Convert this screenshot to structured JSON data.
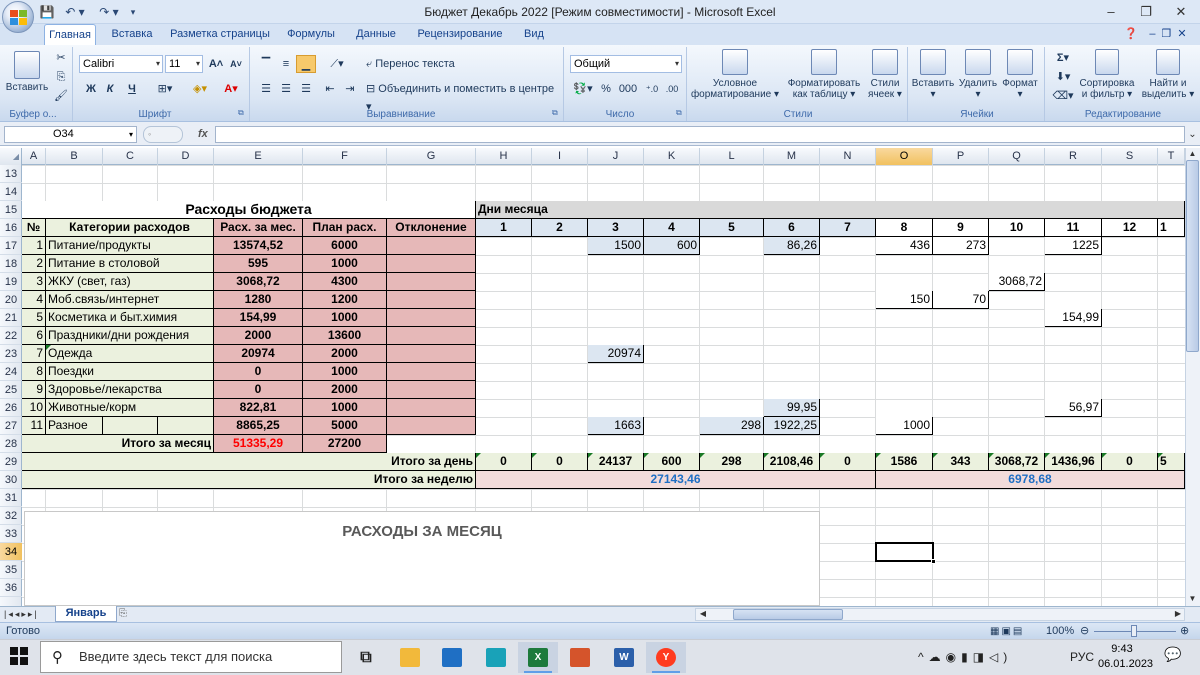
{
  "window": {
    "title": "Бюджет Декабрь 2022  [Режим совместимости]  -  Microsoft Excel",
    "controls": [
      "–",
      "❐",
      "✕"
    ]
  },
  "ribbon": {
    "tabs": [
      "Главная",
      "Вставка",
      "Разметка страницы",
      "Формулы",
      "Данные",
      "Рецензирование",
      "Вид"
    ],
    "groups": {
      "clipboard": {
        "label": "Буфер о...",
        "paste": "Вставить"
      },
      "font": {
        "label": "Шрифт",
        "name": "Calibri",
        "size": "11",
        "bold": "Ж",
        "italic": "К",
        "underline": "Ч"
      },
      "alignment": {
        "label": "Выравнивание",
        "wrap": "Перенос текста",
        "merge": "Объединить и поместить в центре"
      },
      "number": {
        "label": "Число",
        "format": "Общий",
        "percent": "%",
        "thousands": "000"
      },
      "styles": {
        "label": "Стили",
        "conditional": [
          "Условное",
          "форматирование"
        ],
        "table": [
          "Форматировать",
          "как таблицу"
        ],
        "cell_styles": [
          "Стили",
          "ячеек"
        ]
      },
      "cells": {
        "label": "Ячейки",
        "insert": "Вставить",
        "delete": "Удалить",
        "format": "Формат"
      },
      "editing": {
        "label": "Редактирование",
        "sort": [
          "Сортировка",
          "и фильтр"
        ],
        "find": [
          "Найти и",
          "выделить"
        ],
        "sum": "Σ"
      }
    }
  },
  "formula_bar": {
    "name_box": "O34",
    "fx": "fx",
    "content": ""
  },
  "columns": [
    "A",
    "B",
    "C",
    "D",
    "E",
    "F",
    "G",
    "H",
    "I",
    "J",
    "K",
    "L",
    "M",
    "N",
    "O",
    "P",
    "Q",
    "R",
    "S",
    "T"
  ],
  "rows": [
    13,
    14,
    15,
    16,
    17,
    18,
    19,
    20,
    21,
    22,
    23,
    24,
    25,
    26,
    27,
    28,
    29,
    30,
    31,
    32,
    33,
    34,
    35,
    36
  ],
  "selected": {
    "col": "O",
    "row": 34
  },
  "colors": {
    "pink": "#e6b8b8",
    "light_blue": "#dce6f1",
    "green": "#ebf1de",
    "pink_light": "#f2dcdb",
    "gray": "#d9d9d9"
  },
  "cells": [
    {
      "r": 15,
      "c": "A",
      "span": "G",
      "t": "Расходы бюджета",
      "cls": "b c big",
      "bg": "#ffffff"
    },
    {
      "r": 15,
      "c": "H",
      "span": "T",
      "t": "Дни месяца",
      "cls": "b l nbtop",
      "bg": "#d9d9d9"
    },
    {
      "r": 16,
      "c": "A",
      "t": "№",
      "cls": "b c",
      "bg": "#ebf1de"
    },
    {
      "r": 16,
      "c": "B",
      "span": "D",
      "t": "Категории расходов",
      "cls": "b c",
      "bg": "#ebf1de"
    },
    {
      "r": 16,
      "c": "E",
      "t": "Расх. за мес.",
      "cls": "b c",
      "bg": "#e6b8b8"
    },
    {
      "r": 16,
      "c": "F",
      "t": "План расх.",
      "cls": "b c",
      "bg": "#e6b8b8"
    },
    {
      "r": 16,
      "c": "G",
      "t": "Отклонение",
      "cls": "b c",
      "bg": "#e6b8b8"
    },
    {
      "r": 16,
      "c": "H",
      "t": "1",
      "cls": "b c",
      "bg": "#dce6f1"
    },
    {
      "r": 16,
      "c": "I",
      "t": "2",
      "cls": "b c",
      "bg": "#dce6f1"
    },
    {
      "r": 16,
      "c": "J",
      "t": "3",
      "cls": "b c",
      "bg": "#dce6f1"
    },
    {
      "r": 16,
      "c": "K",
      "t": "4",
      "cls": "b c",
      "bg": "#dce6f1"
    },
    {
      "r": 16,
      "c": "L",
      "t": "5",
      "cls": "b c",
      "bg": "#dce6f1"
    },
    {
      "r": 16,
      "c": "M",
      "t": "6",
      "cls": "b c",
      "bg": "#dce6f1"
    },
    {
      "r": 16,
      "c": "N",
      "t": "7",
      "cls": "b c",
      "bg": "#dce6f1"
    },
    {
      "r": 16,
      "c": "O",
      "t": "8",
      "cls": "b c",
      "bg": "#ffffff"
    },
    {
      "r": 16,
      "c": "P",
      "t": "9",
      "cls": "b c",
      "bg": "#ffffff"
    },
    {
      "r": 16,
      "c": "Q",
      "t": "10",
      "cls": "b c",
      "bg": "#ffffff"
    },
    {
      "r": 16,
      "c": "R",
      "t": "11",
      "cls": "b c",
      "bg": "#ffffff"
    },
    {
      "r": 16,
      "c": "S",
      "t": "12",
      "cls": "b c",
      "bg": "#ffffff"
    },
    {
      "r": 16,
      "c": "T",
      "t": "1",
      "cls": "b l",
      "bg": "#ffffff"
    },
    {
      "r": 17,
      "c": "A",
      "t": "1",
      "cls": "r",
      "bg": "#ebf1de"
    },
    {
      "r": 17,
      "c": "B",
      "span": "D",
      "t": "Питание/продукты",
      "cls": "l",
      "bg": "#ebf1de"
    },
    {
      "r": 17,
      "c": "E",
      "t": "13574,52",
      "cls": "b c",
      "bg": "#e6b8b8"
    },
    {
      "r": 17,
      "c": "F",
      "t": "6000",
      "cls": "b c",
      "bg": "#e6b8b8"
    },
    {
      "r": 17,
      "c": "G",
      "t": "",
      "bg": "#e6b8b8"
    },
    {
      "r": 17,
      "c": "J",
      "t": "1500",
      "cls": "r",
      "bg": "#dce6f1"
    },
    {
      "r": 17,
      "c": "K",
      "t": "600",
      "cls": "r",
      "bg": "#dce6f1"
    },
    {
      "r": 17,
      "c": "M",
      "t": "86,26",
      "cls": "r",
      "bg": "#dce6f1"
    },
    {
      "r": 17,
      "c": "O",
      "t": "436",
      "cls": "r",
      "bg": "#ffffff"
    },
    {
      "r": 17,
      "c": "P",
      "t": "273",
      "cls": "r",
      "bg": "#ffffff"
    },
    {
      "r": 17,
      "c": "R",
      "t": "1225",
      "cls": "r",
      "bg": "#ffffff"
    },
    {
      "r": 18,
      "c": "A",
      "t": "2",
      "cls": "r",
      "bg": "#ebf1de"
    },
    {
      "r": 18,
      "c": "B",
      "span": "D",
      "t": "Питание в столовой",
      "cls": "l",
      "bg": "#ebf1de"
    },
    {
      "r": 18,
      "c": "E",
      "t": "595",
      "cls": "b c",
      "bg": "#e6b8b8"
    },
    {
      "r": 18,
      "c": "F",
      "t": "1000",
      "cls": "b c",
      "bg": "#e6b8b8"
    },
    {
      "r": 18,
      "c": "G",
      "t": "",
      "bg": "#e6b8b8"
    },
    {
      "r": 19,
      "c": "A",
      "t": "3",
      "cls": "r",
      "bg": "#ebf1de"
    },
    {
      "r": 19,
      "c": "B",
      "span": "D",
      "t": "ЖКУ (свет, газ)",
      "cls": "l",
      "bg": "#ebf1de"
    },
    {
      "r": 19,
      "c": "E",
      "t": "3068,72",
      "cls": "b c",
      "bg": "#e6b8b8"
    },
    {
      "r": 19,
      "c": "F",
      "t": "4300",
      "cls": "b c",
      "bg": "#e6b8b8"
    },
    {
      "r": 19,
      "c": "G",
      "t": "",
      "bg": "#e6b8b8"
    },
    {
      "r": 19,
      "c": "Q",
      "t": "3068,72",
      "cls": "r",
      "bg": "#ffffff"
    },
    {
      "r": 20,
      "c": "A",
      "t": "4",
      "cls": "r",
      "bg": "#ebf1de"
    },
    {
      "r": 20,
      "c": "B",
      "span": "D",
      "t": "Моб.связь/интернет",
      "cls": "l",
      "bg": "#ebf1de"
    },
    {
      "r": 20,
      "c": "E",
      "t": "1280",
      "cls": "b c",
      "bg": "#e6b8b8"
    },
    {
      "r": 20,
      "c": "F",
      "t": "1200",
      "cls": "b c",
      "bg": "#e6b8b8"
    },
    {
      "r": 20,
      "c": "G",
      "t": "",
      "bg": "#e6b8b8"
    },
    {
      "r": 20,
      "c": "O",
      "t": "150",
      "cls": "r",
      "bg": "#ffffff"
    },
    {
      "r": 20,
      "c": "P",
      "t": "70",
      "cls": "r",
      "bg": "#ffffff"
    },
    {
      "r": 21,
      "c": "A",
      "t": "5",
      "cls": "r",
      "bg": "#ebf1de"
    },
    {
      "r": 21,
      "c": "B",
      "span": "D",
      "t": "Косметика и быт.химия",
      "cls": "l",
      "bg": "#ebf1de"
    },
    {
      "r": 21,
      "c": "E",
      "t": "154,99",
      "cls": "b c",
      "bg": "#e6b8b8"
    },
    {
      "r": 21,
      "c": "F",
      "t": "1000",
      "cls": "b c",
      "bg": "#e6b8b8"
    },
    {
      "r": 21,
      "c": "G",
      "t": "",
      "bg": "#e6b8b8"
    },
    {
      "r": 21,
      "c": "R",
      "t": "154,99",
      "cls": "r",
      "bg": "#ffffff"
    },
    {
      "r": 22,
      "c": "A",
      "t": "6",
      "cls": "r",
      "bg": "#ebf1de"
    },
    {
      "r": 22,
      "c": "B",
      "span": "D",
      "t": "Праздники/дни рождения",
      "cls": "l",
      "bg": "#ebf1de"
    },
    {
      "r": 22,
      "c": "E",
      "t": "2000",
      "cls": "b c",
      "bg": "#e6b8b8"
    },
    {
      "r": 22,
      "c": "F",
      "t": "13600",
      "cls": "b c",
      "bg": "#e6b8b8"
    },
    {
      "r": 22,
      "c": "G",
      "t": "",
      "bg": "#e6b8b8"
    },
    {
      "r": 23,
      "c": "A",
      "t": "7",
      "cls": "r",
      "bg": "#ebf1de"
    },
    {
      "r": 23,
      "c": "B",
      "span": "D",
      "t": "Одежда",
      "cls": "l tri",
      "bg": "#ebf1de"
    },
    {
      "r": 23,
      "c": "E",
      "t": "20974",
      "cls": "b c",
      "bg": "#e6b8b8"
    },
    {
      "r": 23,
      "c": "F",
      "t": "2000",
      "cls": "b c",
      "bg": "#e6b8b8"
    },
    {
      "r": 23,
      "c": "G",
      "t": "",
      "bg": "#e6b8b8"
    },
    {
      "r": 23,
      "c": "J",
      "t": "20974",
      "cls": "r",
      "bg": "#dce6f1"
    },
    {
      "r": 24,
      "c": "A",
      "t": "8",
      "cls": "r",
      "bg": "#ebf1de"
    },
    {
      "r": 24,
      "c": "B",
      "span": "D",
      "t": "Поездки",
      "cls": "l",
      "bg": "#ebf1de"
    },
    {
      "r": 24,
      "c": "E",
      "t": "0",
      "cls": "b c",
      "bg": "#e6b8b8"
    },
    {
      "r": 24,
      "c": "F",
      "t": "1000",
      "cls": "b c",
      "bg": "#e6b8b8"
    },
    {
      "r": 24,
      "c": "G",
      "t": "",
      "bg": "#e6b8b8"
    },
    {
      "r": 25,
      "c": "A",
      "t": "9",
      "cls": "r",
      "bg": "#ebf1de"
    },
    {
      "r": 25,
      "c": "B",
      "span": "D",
      "t": "Здоровье/лекарства",
      "cls": "l",
      "bg": "#ebf1de"
    },
    {
      "r": 25,
      "c": "E",
      "t": "0",
      "cls": "b c",
      "bg": "#e6b8b8"
    },
    {
      "r": 25,
      "c": "F",
      "t": "2000",
      "cls": "b c",
      "bg": "#e6b8b8"
    },
    {
      "r": 25,
      "c": "G",
      "t": "",
      "bg": "#e6b8b8"
    },
    {
      "r": 26,
      "c": "A",
      "t": "10",
      "cls": "r",
      "bg": "#ebf1de"
    },
    {
      "r": 26,
      "c": "B",
      "span": "D",
      "t": "Животные/корм",
      "cls": "l",
      "bg": "#ebf1de"
    },
    {
      "r": 26,
      "c": "E",
      "t": "822,81",
      "cls": "b c",
      "bg": "#e6b8b8"
    },
    {
      "r": 26,
      "c": "F",
      "t": "1000",
      "cls": "b c",
      "bg": "#e6b8b8"
    },
    {
      "r": 26,
      "c": "G",
      "t": "",
      "bg": "#e6b8b8"
    },
    {
      "r": 26,
      "c": "M",
      "t": "99,95",
      "cls": "r",
      "bg": "#dce6f1"
    },
    {
      "r": 26,
      "c": "R",
      "t": "56,97",
      "cls": "r",
      "bg": "#ffffff"
    },
    {
      "r": 27,
      "c": "A",
      "t": "11",
      "cls": "r",
      "bg": "#ebf1de"
    },
    {
      "r": 27,
      "c": "B",
      "t": "Разное",
      "cls": "l",
      "bg": "#ebf1de"
    },
    {
      "r": 27,
      "c": "C",
      "t": "",
      "bg": "#ebf1de"
    },
    {
      "r": 27,
      "c": "D",
      "t": "",
      "bg": "#ebf1de"
    },
    {
      "r": 27,
      "c": "E",
      "t": "8865,25",
      "cls": "b c",
      "bg": "#e6b8b8"
    },
    {
      "r": 27,
      "c": "F",
      "t": "5000",
      "cls": "b c",
      "bg": "#e6b8b8"
    },
    {
      "r": 27,
      "c": "G",
      "t": "",
      "bg": "#e6b8b8"
    },
    {
      "r": 27,
      "c": "J",
      "t": "1663",
      "cls": "r",
      "bg": "#dce6f1"
    },
    {
      "r": 27,
      "c": "L",
      "t": "298",
      "cls": "r",
      "bg": "#dce6f1"
    },
    {
      "r": 27,
      "c": "M",
      "t": "1922,25",
      "cls": "r",
      "bg": "#dce6f1"
    },
    {
      "r": 27,
      "c": "O",
      "t": "1000",
      "cls": "r",
      "bg": "#ffffff"
    },
    {
      "r": 28,
      "c": "A",
      "span": "D",
      "t": "Итого за месяц",
      "cls": "b r",
      "bg": "#ebf1de"
    },
    {
      "r": 28,
      "c": "E",
      "t": "51335,29",
      "cls": "b c red",
      "bg": "#e6b8b8"
    },
    {
      "r": 28,
      "c": "F",
      "t": "27200",
      "cls": "b c",
      "bg": "#e6b8b8"
    },
    {
      "r": 29,
      "c": "A",
      "span": "G",
      "t": "Итого за день",
      "cls": "b r",
      "bg": "#ebf1de"
    },
    {
      "r": 29,
      "c": "H",
      "t": "0",
      "cls": "b c tri",
      "bg": "#ebf1de"
    },
    {
      "r": 29,
      "c": "I",
      "t": "0",
      "cls": "b c tri",
      "bg": "#ebf1de"
    },
    {
      "r": 29,
      "c": "J",
      "t": "24137",
      "cls": "b c tri",
      "bg": "#ebf1de"
    },
    {
      "r": 29,
      "c": "K",
      "t": "600",
      "cls": "b c tri",
      "bg": "#ebf1de"
    },
    {
      "r": 29,
      "c": "L",
      "t": "298",
      "cls": "b c tri",
      "bg": "#ebf1de"
    },
    {
      "r": 29,
      "c": "M",
      "t": "2108,46",
      "cls": "b c tri",
      "bg": "#ebf1de"
    },
    {
      "r": 29,
      "c": "N",
      "t": "0",
      "cls": "b c tri",
      "bg": "#ebf1de"
    },
    {
      "r": 29,
      "c": "O",
      "t": "1586",
      "cls": "b c tri",
      "bg": "#ebf1de"
    },
    {
      "r": 29,
      "c": "P",
      "t": "343",
      "cls": "b c tri",
      "bg": "#ebf1de"
    },
    {
      "r": 29,
      "c": "Q",
      "t": "3068,72",
      "cls": "b c tri",
      "bg": "#ebf1de"
    },
    {
      "r": 29,
      "c": "R",
      "t": "1436,96",
      "cls": "b c tri",
      "bg": "#ebf1de"
    },
    {
      "r": 29,
      "c": "S",
      "t": "0",
      "cls": "b c tri",
      "bg": "#ebf1de"
    },
    {
      "r": 29,
      "c": "T",
      "t": "5",
      "cls": "b l tri",
      "bg": "#ebf1de"
    },
    {
      "r": 30,
      "c": "A",
      "span": "G",
      "t": "Итого за неделю",
      "cls": "b r",
      "bg": "#ebf1de"
    },
    {
      "r": 30,
      "c": "H",
      "span": "N",
      "t": "27143,46",
      "cls": "b c blue",
      "bg": "#f2dcdb"
    },
    {
      "r": 30,
      "c": "O",
      "span": "T",
      "t": "6978,68",
      "cls": "b c blue",
      "bg": "#f2dcdb"
    }
  ],
  "chart": {
    "title": "РАСХОДЫ ЗА МЕСЯЦ"
  },
  "sheet_tabs": {
    "active": "Январь"
  },
  "statusbar": {
    "ready": "Готово",
    "zoom": "100%"
  },
  "taskbar": {
    "search_placeholder": "Введите здесь текст для поиска",
    "lang": "РУС",
    "time": "9:43",
    "date": "06.01.2023"
  }
}
